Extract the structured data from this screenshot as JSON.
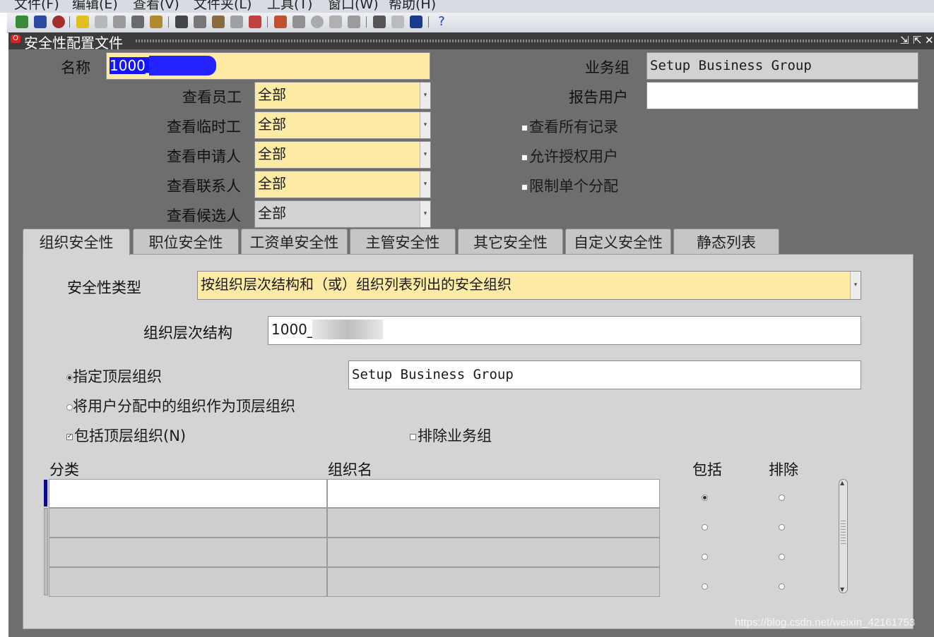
{
  "menu": [
    "文件(F)",
    "编辑(E)",
    "查看(V)",
    "文件夹(L)",
    "工具(T)",
    "窗口(W)",
    "帮助(H)"
  ],
  "window": {
    "title": "安全性配置文件"
  },
  "form": {
    "name_label": "名称",
    "name_value": "1000_",
    "business_group_label": "业务组",
    "business_group_value": "Setup Business Group",
    "report_user_label": "报告用户",
    "report_user_value": "",
    "view_employee_label": "查看员工",
    "view_employee_value": "全部",
    "view_contingent_label": "查看临时工",
    "view_contingent_value": "全部",
    "view_applicant_label": "查看申请人",
    "view_applicant_value": "全部",
    "view_contact_label": "查看联系人",
    "view_contact_value": "全部",
    "view_candidate_label": "查看候选人",
    "view_candidate_value": "全部",
    "view_all_records_label": "查看所有记录",
    "allow_grant_label": "允许授权用户",
    "restrict_single_label": "限制单个分配"
  },
  "tabs": [
    "组织安全性",
    "职位安全性",
    "工资单安全性",
    "主管安全性",
    "其它安全性",
    "自定义安全性",
    "静态列表"
  ],
  "org_security": {
    "security_type_label": "安全性类型",
    "security_type_value": "按组织层次结构和（或）组织列表列出的安全组织",
    "hierarchy_label": "组织层次结构",
    "hierarchy_value": "1000_",
    "specify_top_label": "指定顶层组织",
    "specify_top_value": "Setup Business Group",
    "use_assignment_label": "将用户分配中的组织作为顶层组织",
    "include_top_label": "包括顶层组织(N)",
    "exclude_bg_label": "排除业务组",
    "table_headers": {
      "classification": "分类",
      "org_name": "组织名",
      "include": "包括",
      "exclude": "排除"
    }
  },
  "watermark": "https://blog.csdn.net/weixin_42161753"
}
